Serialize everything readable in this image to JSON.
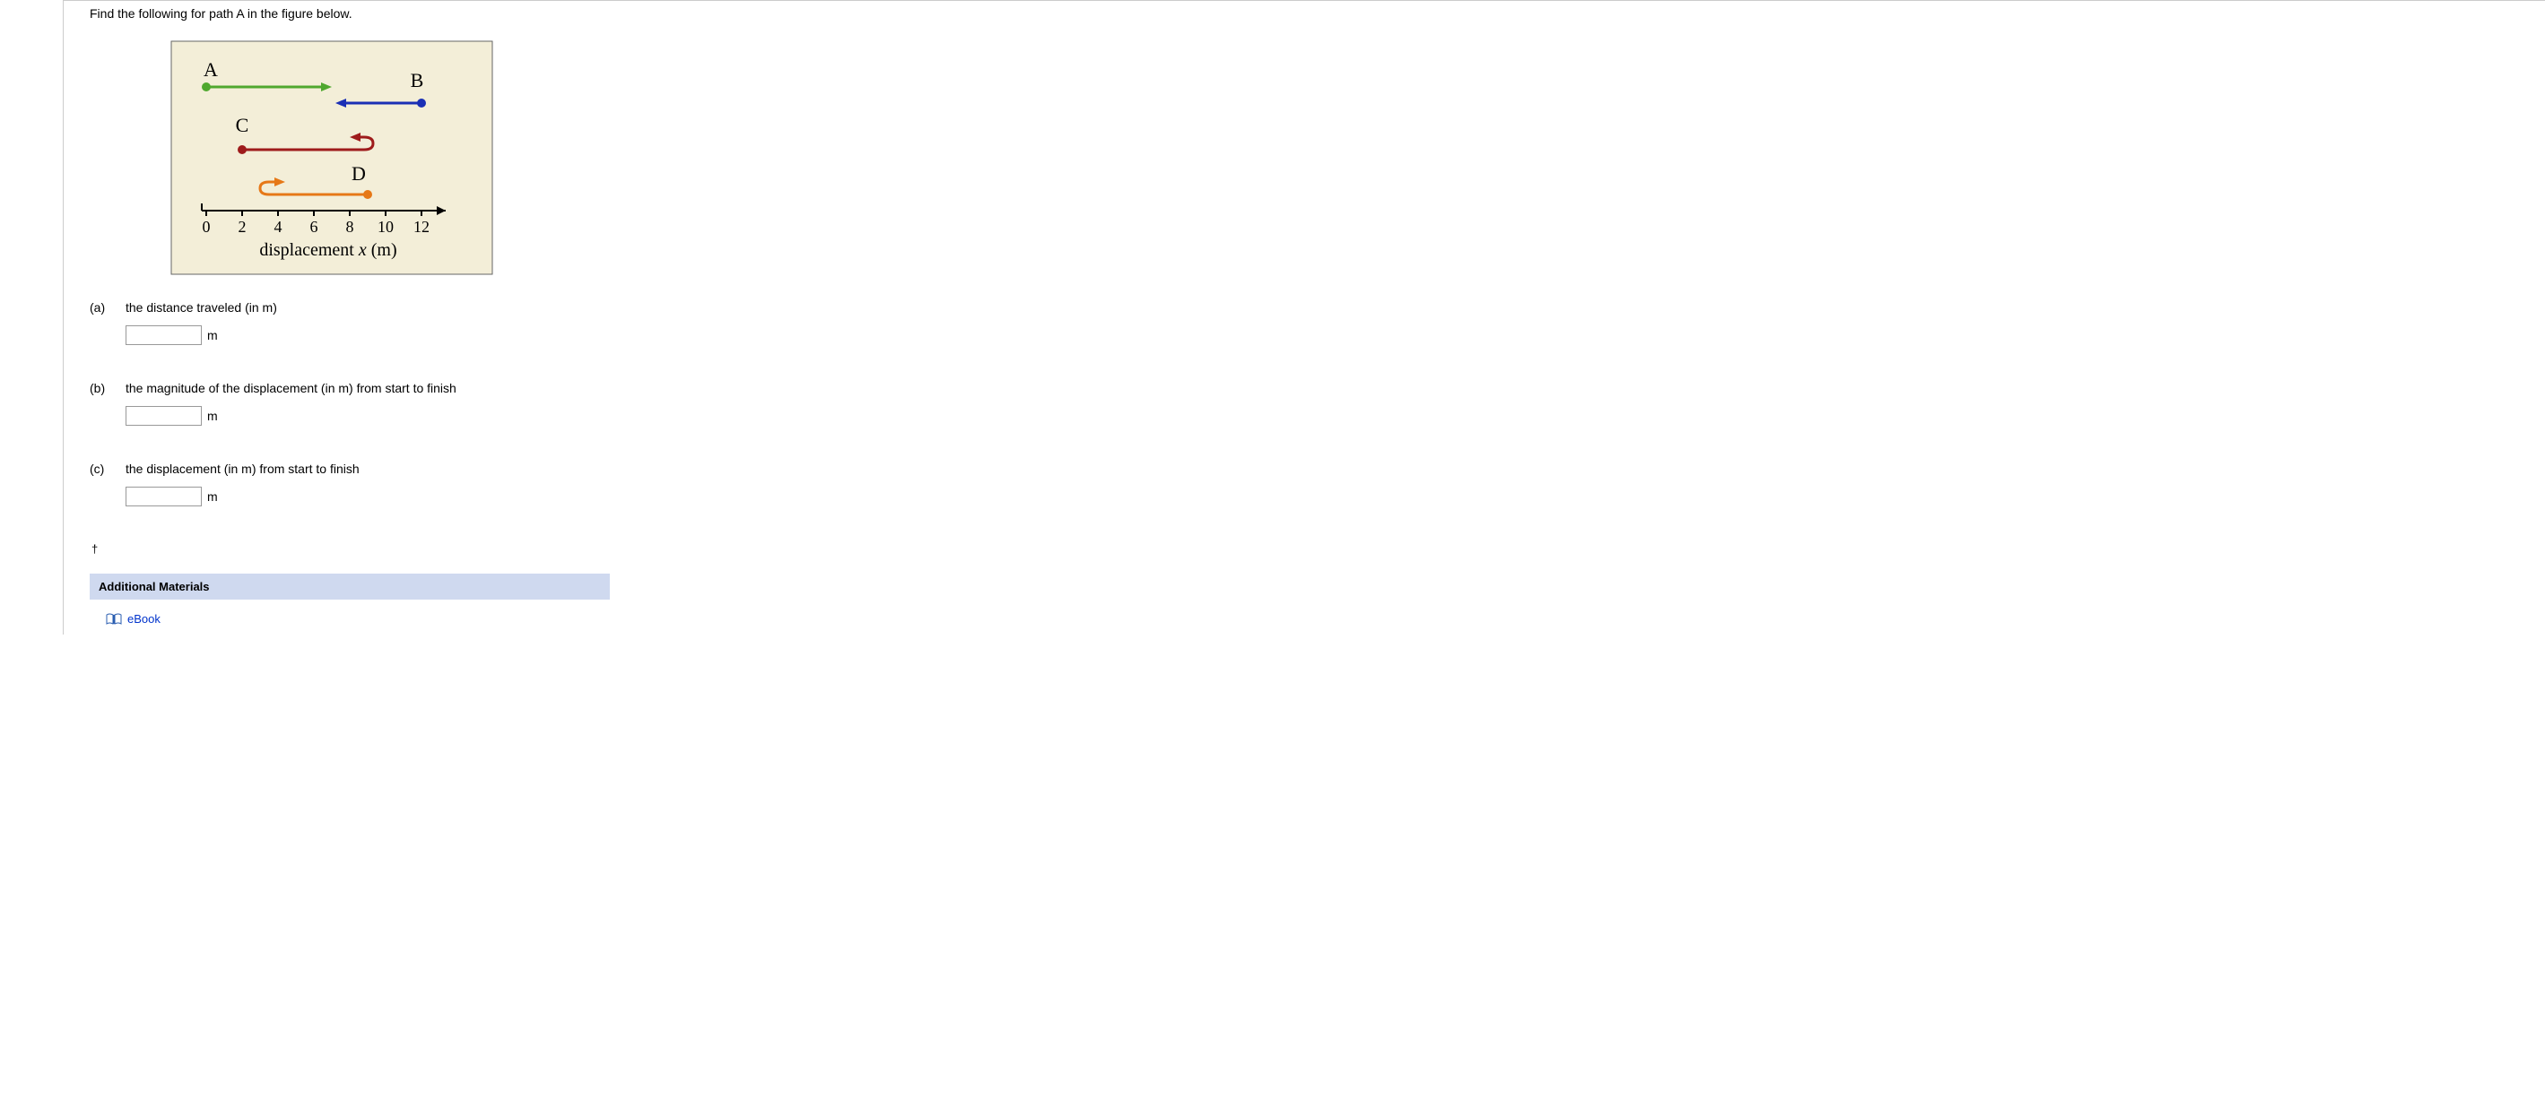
{
  "question": {
    "intro": "Find the following for path A in the figure below."
  },
  "figure": {
    "axis_ticks": [
      "0",
      "2",
      "4",
      "6",
      "8",
      "10",
      "12"
    ],
    "axis_label_text": "displacement",
    "axis_label_var": "x",
    "axis_label_unit": "(m)",
    "paths": {
      "A": "A",
      "B": "B",
      "C": "C",
      "D": "D"
    }
  },
  "parts": {
    "a": {
      "label": "(a)",
      "text": "the distance traveled (in m)",
      "unit": "m"
    },
    "b": {
      "label": "(b)",
      "text": "the magnitude of the displacement (in m) from start to finish",
      "unit": "m"
    },
    "c": {
      "label": "(c)",
      "text": "the displacement (in m) from start to finish",
      "unit": "m"
    }
  },
  "footer": {
    "dagger": "†",
    "additional": "Additional Materials",
    "ebook": "eBook"
  }
}
